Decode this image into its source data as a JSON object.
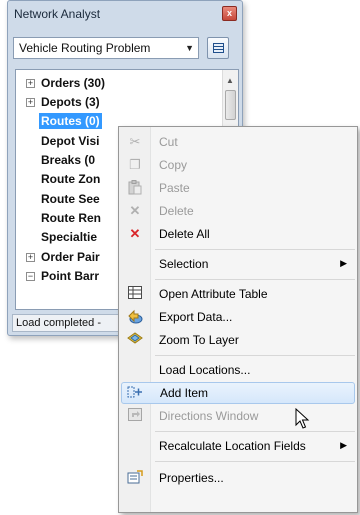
{
  "window": {
    "title": "Network Analyst",
    "close_symbol": "x",
    "combo_value": "Vehicle Routing Problem",
    "combo_arrow": "▼",
    "status": "Load completed - "
  },
  "tree": {
    "items": [
      {
        "label": "Orders (30)",
        "toggle": "+",
        "selected": false
      },
      {
        "label": "Depots (3)",
        "toggle": "+",
        "selected": false
      },
      {
        "label": "Routes (0)",
        "toggle": "",
        "selected": true
      },
      {
        "label": "Depot Visi",
        "toggle": "",
        "selected": false
      },
      {
        "label": "Breaks (0",
        "toggle": "",
        "selected": false
      },
      {
        "label": "Route Zon",
        "toggle": "",
        "selected": false
      },
      {
        "label": "Route See",
        "toggle": "",
        "selected": false
      },
      {
        "label": "Route Ren",
        "toggle": "",
        "selected": false
      },
      {
        "label": "Specialtie",
        "toggle": "",
        "selected": false
      },
      {
        "label": "Order Pair",
        "toggle": "+",
        "selected": false
      },
      {
        "label": "Point Barr",
        "toggle": "−",
        "selected": false
      }
    ]
  },
  "menu": {
    "items": [
      {
        "label": "Cut",
        "icon": "scissors-icon",
        "glyph": "✂",
        "disabled": true
      },
      {
        "label": "Copy",
        "icon": "copy-icon",
        "glyph": "❐",
        "disabled": true
      },
      {
        "label": "Paste",
        "icon": "paste-icon",
        "glyph": "📋",
        "disabled": true
      },
      {
        "label": "Delete",
        "icon": "delete-icon",
        "glyph": "✕",
        "disabled": true
      },
      {
        "label": "Delete All",
        "icon": "delete-all-icon",
        "glyph": "✕",
        "disabled": false
      },
      {
        "label": "Selection",
        "icon": "",
        "glyph": "",
        "disabled": false,
        "submenu": true
      },
      {
        "label": "Open Attribute Table",
        "icon": "attribute-table-icon",
        "glyph": "▦",
        "disabled": false
      },
      {
        "label": "Export Data...",
        "icon": "export-data-icon",
        "glyph": "⇪",
        "disabled": false
      },
      {
        "label": "Zoom To Layer",
        "icon": "zoom-to-layer-icon",
        "glyph": "◆",
        "disabled": false
      },
      {
        "label": "Load Locations...",
        "icon": "",
        "glyph": "",
        "disabled": false
      },
      {
        "label": "Add Item",
        "icon": "add-item-icon",
        "glyph": "⊢",
        "disabled": false,
        "highlight": true
      },
      {
        "label": "Directions Window",
        "icon": "directions-window-icon",
        "glyph": "▣",
        "disabled": true
      },
      {
        "label": "Recalculate Location Fields",
        "icon": "",
        "glyph": "",
        "disabled": false,
        "submenu": true
      },
      {
        "label": "Properties...",
        "icon": "properties-icon",
        "glyph": "☐",
        "disabled": false
      }
    ],
    "submenu_arrow": "▶"
  },
  "colors": {
    "selection": "#3399ff",
    "delete_all_icon": "#d9262a",
    "disabled_text": "#9a9a9a",
    "window_frame": "#cfdbe9"
  }
}
